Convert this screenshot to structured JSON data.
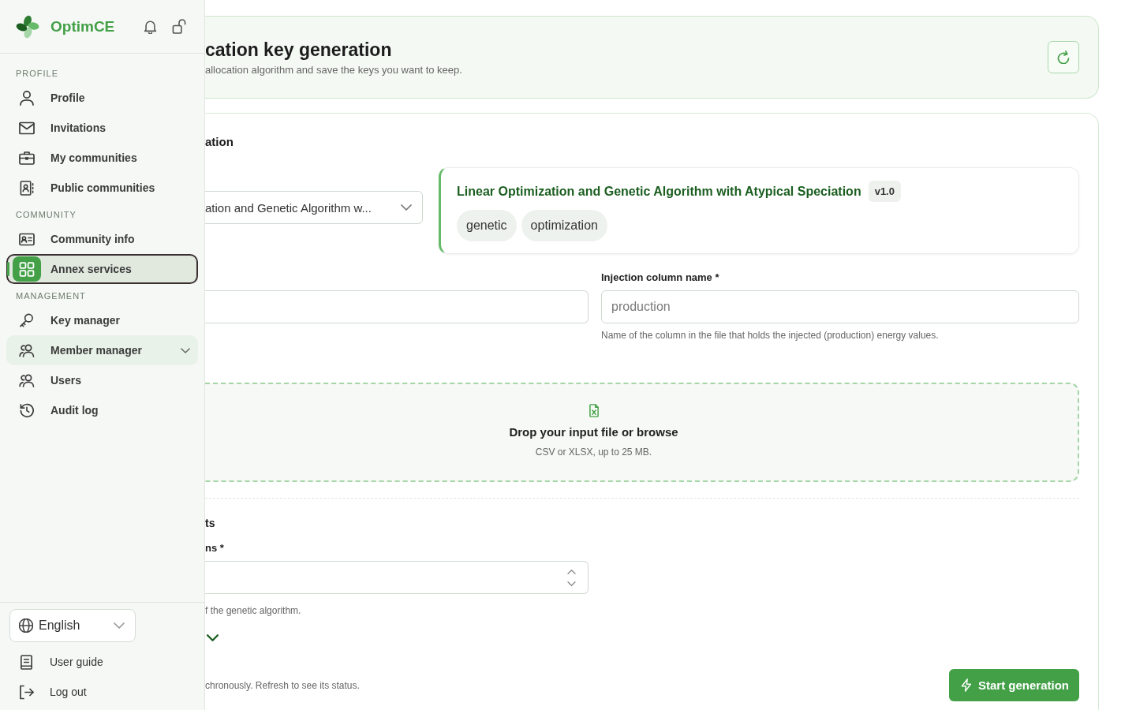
{
  "sidebar": {
    "brand": "OptimCE",
    "sections": [
      {
        "label": "PROFILE",
        "items": [
          {
            "kind": "link",
            "label": "Profile",
            "selected": false
          },
          {
            "kind": "link",
            "label": "Invitations",
            "selected": false
          },
          {
            "kind": "link",
            "label": "My communities",
            "selected": false
          },
          {
            "kind": "link",
            "label": "Public communities",
            "selected": false
          }
        ]
      },
      {
        "label": "COMMUNITY",
        "items": [
          {
            "kind": "link",
            "label": "Community info",
            "selected": false
          },
          {
            "kind": "link",
            "label": "Annex services",
            "selected": true
          }
        ]
      },
      {
        "label": "MANAGEMENT",
        "items": [
          {
            "kind": "link",
            "label": "Key manager",
            "selected": false
          },
          {
            "kind": "group",
            "label": "Member manager",
            "selected": false,
            "expanded": false
          },
          {
            "kind": "link",
            "label": "Users",
            "selected": false
          },
          {
            "kind": "link",
            "label": "Audit log",
            "selected": false
          }
        ]
      }
    ],
    "language": {
      "value": "English"
    },
    "footer_links": [
      {
        "label": "User guide"
      },
      {
        "label": "Log out"
      }
    ]
  },
  "header": {
    "title": "cation key generation",
    "subtitle": "allocation algorithm and save the keys you want to keep."
  },
  "algorithm": {
    "section_title": "ation",
    "select": {
      "value": "ation and Genetic Algorithm w..."
    },
    "card": {
      "title": "Linear Optimization and Genetic Algorithm with Atypical Speciation",
      "version": "v1.0",
      "tags": [
        "genetic",
        "optimization"
      ]
    }
  },
  "columns": [
    {
      "kind": "text"
    },
    {
      "kind": "text",
      "label": "Injection column name *",
      "placeholder": "production",
      "help": "Name of the column in the file that holds the injected (production) energy values."
    }
  ],
  "dropzone": {
    "title": "Drop your input file or browse",
    "hint": "CSV or XLSX, up to 25 MB."
  },
  "params": {
    "section_title": "ts",
    "fields": [
      {
        "kind": "number",
        "label": "ns *",
        "help": "f the genetic algorithm."
      }
    ],
    "advanced_toggle": {
      "expanded": false
    }
  },
  "footer": {
    "note": "chronously. Refresh to see its status.",
    "button": "Start generation"
  }
}
